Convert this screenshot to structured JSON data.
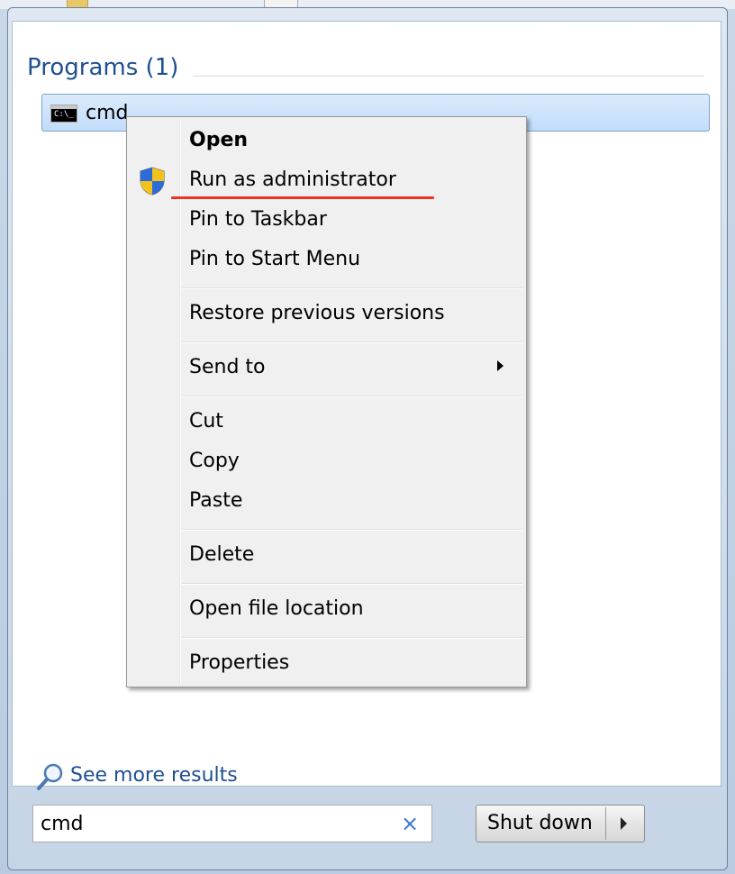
{
  "start_menu": {
    "section_header": "Programs (1)",
    "result": {
      "label": "cmd",
      "icon": "cmd-console-icon",
      "icon_text": "C:\\_"
    },
    "see_more": "See more results",
    "search": {
      "value": "cmd",
      "clear_icon": "clear-x-icon"
    },
    "shutdown": {
      "label": "Shut down"
    }
  },
  "context_menu": {
    "items": [
      {
        "label": "Open",
        "bold": true
      },
      {
        "label": "Run as administrator",
        "icon": "uac-shield-icon"
      },
      {
        "label": "Pin to Taskbar"
      },
      {
        "label": "Pin to Start Menu"
      },
      {
        "label": "Restore previous versions"
      },
      {
        "label": "Send to",
        "submenu": true
      },
      {
        "label": "Cut"
      },
      {
        "label": "Copy"
      },
      {
        "label": "Paste"
      },
      {
        "label": "Delete"
      },
      {
        "label": "Open file location"
      },
      {
        "label": "Properties"
      }
    ],
    "highlight_color": "#e8342a"
  },
  "colors": {
    "accent_text": "#1e4f91",
    "selection_bg": "#c1dcfb"
  }
}
